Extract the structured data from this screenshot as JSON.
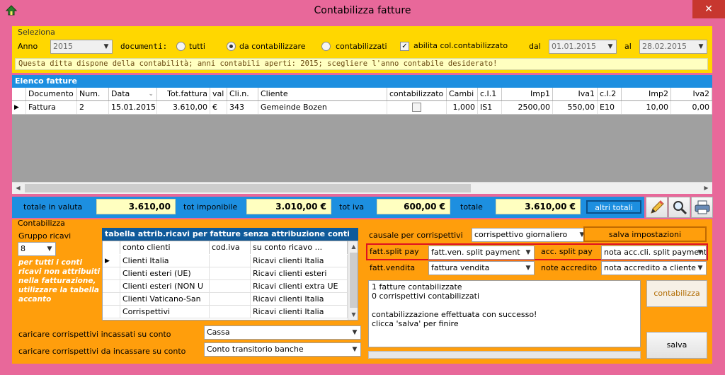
{
  "window": {
    "title": "Contabilizza fatture"
  },
  "seleziona": {
    "legend": "Seleziona",
    "anno_label": "Anno",
    "anno_value": "2015",
    "documenti_label": "documenti:",
    "radio_tutti": "tutti",
    "radio_da_contabilizzare": "da contabilizzare",
    "radio_contabilizzati": "contabilizzati",
    "abilita_label": "abilita col.contabilizzato",
    "dal_label": "dal",
    "dal_value": "01.01.2015",
    "al_label": "al",
    "al_value": "28.02.2015",
    "info": "Questa ditta dispone della contabilità; anni contabili aperti: 2015; scegliere l'anno contabile desiderato!"
  },
  "elenco": {
    "title": "Elenco fatture",
    "columns": [
      "Documento",
      "Num.",
      "Data",
      "Tot.fattura",
      "val",
      "Cli.n.",
      "Cliente",
      "contabilizzato",
      "Cambi",
      "c.I.1",
      "Imp1",
      "Iva1",
      "c.I.2",
      "Imp2",
      "Iva2"
    ],
    "rows": [
      [
        "Fattura",
        "2",
        "15.01.2015",
        "3.610,00",
        "€",
        "343",
        "Gemeinde Bozen",
        "",
        "1,000",
        "IS1",
        "2500,00",
        "550,00",
        "E10",
        "10,00",
        "0,00"
      ]
    ]
  },
  "totali": {
    "valuta_label": "totale in valuta",
    "valuta_value": "3.610,00",
    "imponibile_label": "tot imponibile",
    "imponibile_value": "3.010,00 €",
    "iva_label": "tot iva",
    "iva_value": "600,00 €",
    "totale_label": "totale",
    "totale_value": "3.610,00 €",
    "altri_totali": "altri totali"
  },
  "contabilizza": {
    "legend": "Contabilizza",
    "gruppo_label": "Gruppo ricavi",
    "gruppo_value": "8",
    "note": [
      "per tutti i conti",
      "ricavi non attribuiti",
      "nella fatturazione,",
      "utilizzare la tabella",
      "accanto"
    ],
    "tabella_title": "tabella attrib.ricavi per fatture senza attribuzione conti",
    "tabella_columns": [
      "conto clienti",
      "cod.iva",
      "su conto ricavo ..."
    ],
    "tabella_rows": [
      [
        "Clienti Italia",
        "",
        "Ricavi clienti Italia"
      ],
      [
        "Clienti esteri (UE)",
        "",
        "Ricavi clienti esteri"
      ],
      [
        "Clienti esteri (NON U",
        "",
        "Ricavi clienti extra UE"
      ],
      [
        "Clienti Vaticano-San",
        "",
        "Ricavi clienti Italia"
      ],
      [
        "Corrispettivi",
        "",
        "Ricavi clienti Italia"
      ]
    ],
    "incassati_label": "caricare corrispettivi incassati su conto",
    "incassati_value": "Cassa",
    "da_incassare_label": "caricare corrispettivi da incassare su conto",
    "da_incassare_value": "Conto transitorio banche",
    "causale_label": "causale per corrispettivi",
    "causale_value": "corrispettivo giornaliero",
    "salva_impostazioni": "salva impostazioni",
    "fatt_split_label": "fatt.split pay",
    "fatt_split_value": "fatt.ven. split payment",
    "acc_split_label": "acc. split pay",
    "acc_split_value": "nota acc.cli. split payment",
    "fatt_vendita_label": "fatt.vendita",
    "fatt_vendita_value": "fattura vendita",
    "note_accredito_label": "note accredito",
    "note_accredito_value": "nota accredito a cliente",
    "log": [
      "1 fatture contabilizzate",
      "0 corrispettivi contabilizzati",
      "",
      "contabilizzazione effettuata con successo!",
      "clicca 'salva' per finire"
    ],
    "contabilizza_button": "contabilizza",
    "salva_button": "salva"
  },
  "colors": {
    "window_frame": "#e8689a",
    "panel_yellow": "#ffd700",
    "panel_orange": "#ff9e0c",
    "grid_gray": "#a0a0a0",
    "totals_blue": "#1d8fe0",
    "highlight_red": "#e01020"
  }
}
